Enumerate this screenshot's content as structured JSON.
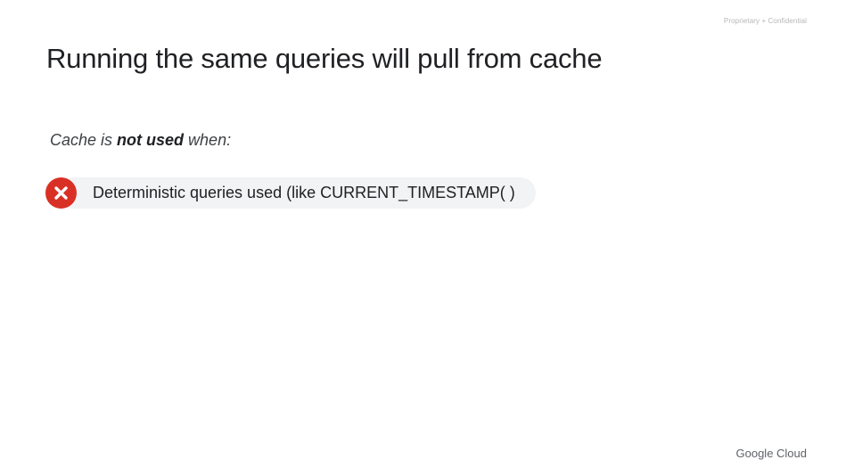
{
  "header": {
    "confidential_label": "Proprietary + Confidential"
  },
  "slide": {
    "title": "Running the same queries will pull from cache",
    "subtitle": {
      "prefix": "Cache is ",
      "emphasis": "not used",
      "suffix": " when:"
    },
    "items": [
      {
        "icon": "x-circle-icon",
        "text": "Deterministic queries used (like CURRENT_TIMESTAMP( )"
      }
    ]
  },
  "footer": {
    "logo_text": "Google Cloud"
  },
  "colors": {
    "title": "#202124",
    "icon_red": "#d93025",
    "pill_background": "#f1f3f4"
  }
}
